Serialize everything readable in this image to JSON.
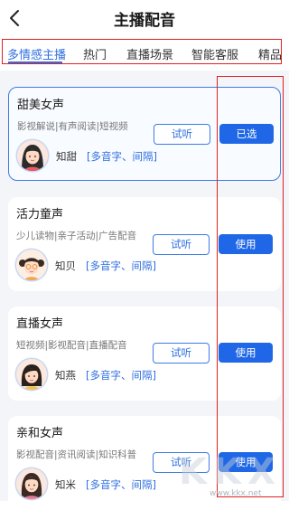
{
  "header": {
    "back_icon": "chevron-left-icon",
    "title": "主播配音"
  },
  "tabs": [
    {
      "label": "多情感主播",
      "active": true
    },
    {
      "label": "热门",
      "active": false
    },
    {
      "label": "直播场景",
      "active": false
    },
    {
      "label": "智能客服",
      "active": false
    },
    {
      "label": "精品",
      "active": false
    }
  ],
  "voices": [
    {
      "name": "甜美女声",
      "tags": "影视解说|有声阅读|短视频",
      "nickname": "知甜",
      "features": "[多音字、间隔]",
      "listen_label": "试听",
      "action_label": "已选",
      "selected": true
    },
    {
      "name": "活力童声",
      "tags": "少儿读物|亲子活动|广告配音",
      "nickname": "知贝",
      "features": "[多音字、间隔]",
      "listen_label": "试听",
      "action_label": "使用",
      "selected": false
    },
    {
      "name": "直播女声",
      "tags": "短视频|影视配音|直播配音",
      "nickname": "知燕",
      "features": "[多音字、间隔]",
      "listen_label": "试听",
      "action_label": "使用",
      "selected": false
    },
    {
      "name": "亲和女声",
      "tags": "影视配音|资讯阅读|知识科普",
      "nickname": "知米",
      "features": "[多音字、间隔]",
      "listen_label": "试听",
      "action_label": "使用",
      "selected": false
    }
  ],
  "watermark": {
    "text": "www.kkx.net"
  },
  "colors": {
    "accent": "#1f67e6",
    "highlight_border": "#e02020",
    "page_background": "#f3f5f9"
  }
}
